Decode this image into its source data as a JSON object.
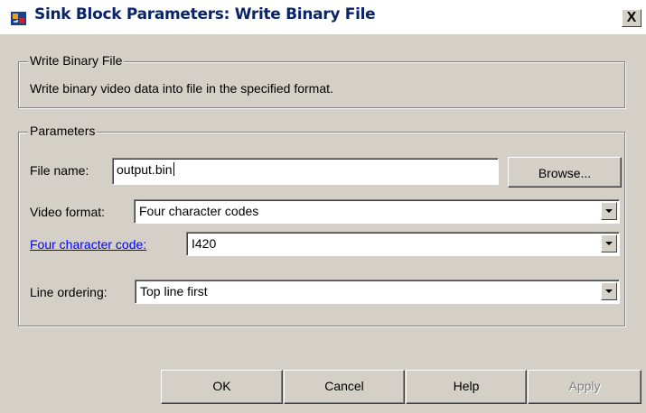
{
  "window": {
    "title": "Sink Block Parameters: Write Binary File",
    "close_label": "X"
  },
  "description_group": {
    "legend": "Write Binary File",
    "text": "Write binary video data into file in the specified format."
  },
  "parameters_group": {
    "legend": "Parameters",
    "file_name": {
      "label": "File name:",
      "value": "output.bin",
      "browse_label": "Browse..."
    },
    "video_format": {
      "label": "Video format:",
      "value": "Four character codes"
    },
    "four_cc": {
      "label": "Four character code:",
      "value": "I420"
    },
    "line_ordering": {
      "label": "Line ordering:",
      "value": "Top line first"
    }
  },
  "buttons": {
    "ok": "OK",
    "cancel": "Cancel",
    "help": "Help",
    "apply": "Apply"
  },
  "colors": {
    "dialog_bg": "#d4d0c8",
    "title_text": "#0a246a",
    "link": "#0000ff"
  },
  "icons": {
    "title": "simulink-block-icon"
  }
}
